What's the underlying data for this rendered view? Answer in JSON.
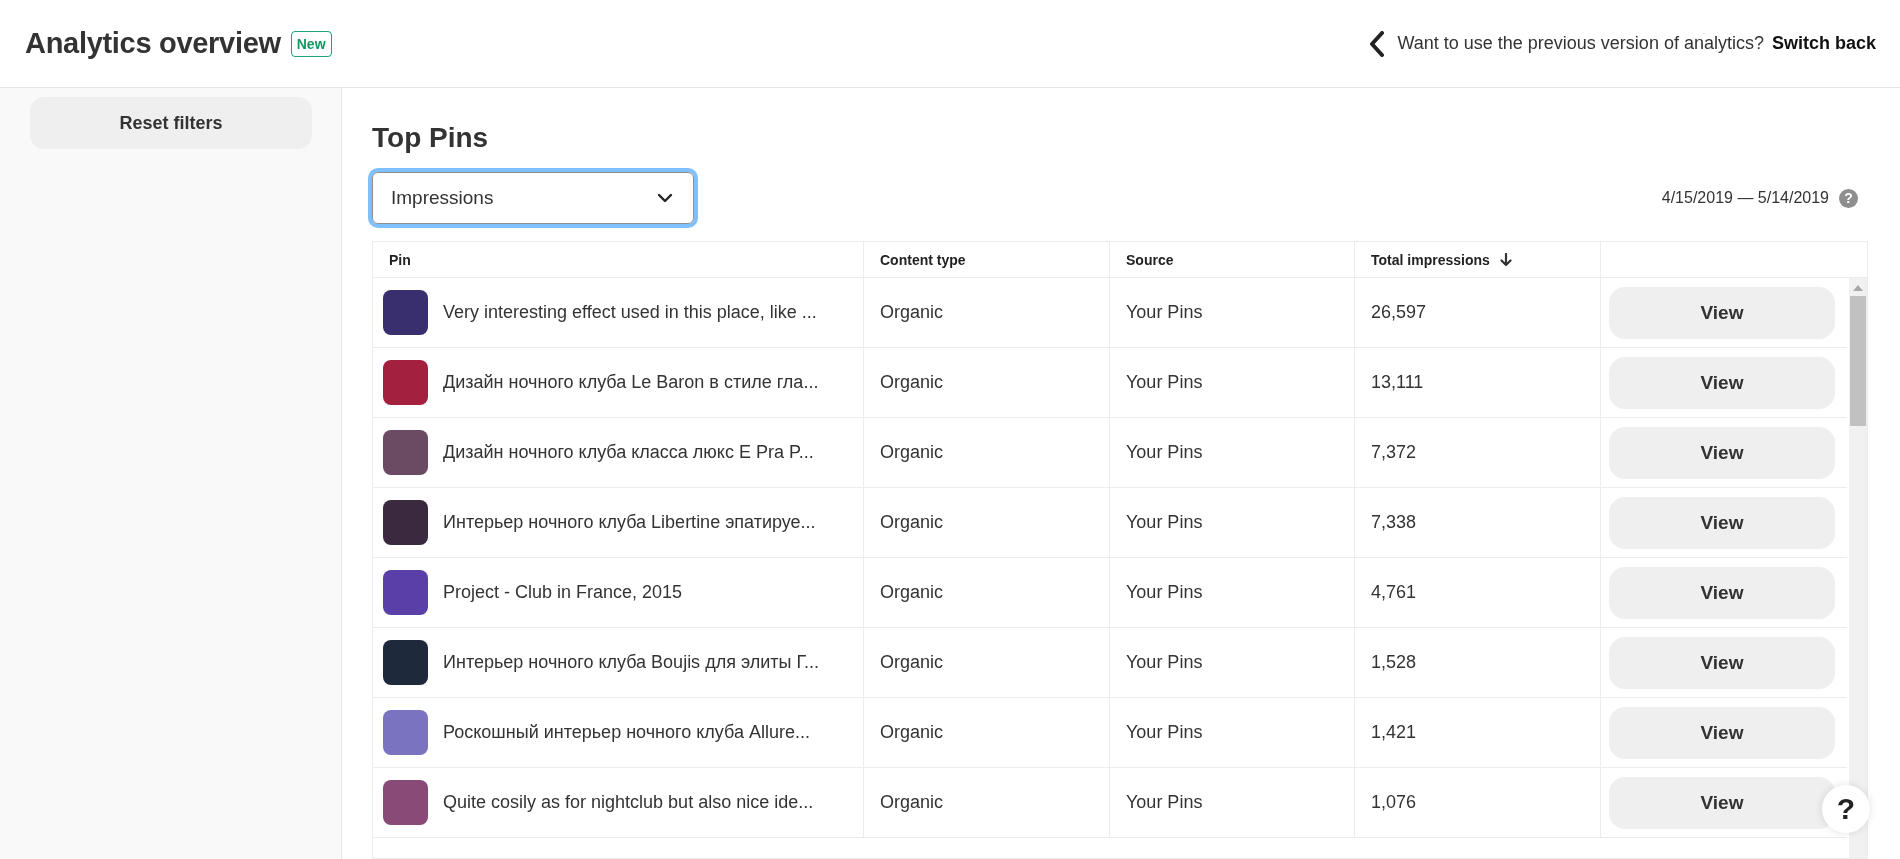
{
  "header": {
    "title": "Analytics overview",
    "badge": "New",
    "notice": "Want to use the previous version of analytics?",
    "link": "Switch back"
  },
  "sidebar": {
    "reset_button": "Reset filters"
  },
  "section": {
    "title": "Top Pins",
    "dropdown": {
      "value": "Impressions"
    },
    "date_range": "4/15/2019 — 5/14/2019",
    "help_icon": "?"
  },
  "table": {
    "columns": [
      {
        "label": "Pin",
        "sorted": false
      },
      {
        "label": "Content type",
        "sorted": false
      },
      {
        "label": "Source",
        "sorted": false
      },
      {
        "label": "Total impressions",
        "sorted": true
      }
    ],
    "rows": [
      {
        "pin": "Very interesting effect used in this place, like ...",
        "content_type": "Organic",
        "source": "Your Pins",
        "impressions": "26,597",
        "action": "View"
      },
      {
        "pin": "Дизайн ночного клуба Le Baron в стиле гла...",
        "content_type": "Organic",
        "source": "Your Pins",
        "impressions": "13,111",
        "action": "View"
      },
      {
        "pin": "Дизайн ночного клуба класса люкс E Pra P...",
        "content_type": "Organic",
        "source": "Your Pins",
        "impressions": "7,372",
        "action": "View"
      },
      {
        "pin": "Интерьер ночного клуба Libertine эпатируе...",
        "content_type": "Organic",
        "source": "Your Pins",
        "impressions": "7,338",
        "action": "View"
      },
      {
        "pin": "Project - Club in France, 2015",
        "content_type": "Organic",
        "source": "Your Pins",
        "impressions": "4,761",
        "action": "View"
      },
      {
        "pin": "Интерьер ночного клуба Boujis для элиты Г...",
        "content_type": "Organic",
        "source": "Your Pins",
        "impressions": "1,528",
        "action": "View"
      },
      {
        "pin": "Роскошный интерьер ночного клуба Allure...",
        "content_type": "Organic",
        "source": "Your Pins",
        "impressions": "1,421",
        "action": "View"
      },
      {
        "pin": "Quite cosily as for nightclub but also nice ide...",
        "content_type": "Organic",
        "source": "Your Pins",
        "impressions": "1,076",
        "action": "View"
      }
    ]
  },
  "help_button": "?"
}
